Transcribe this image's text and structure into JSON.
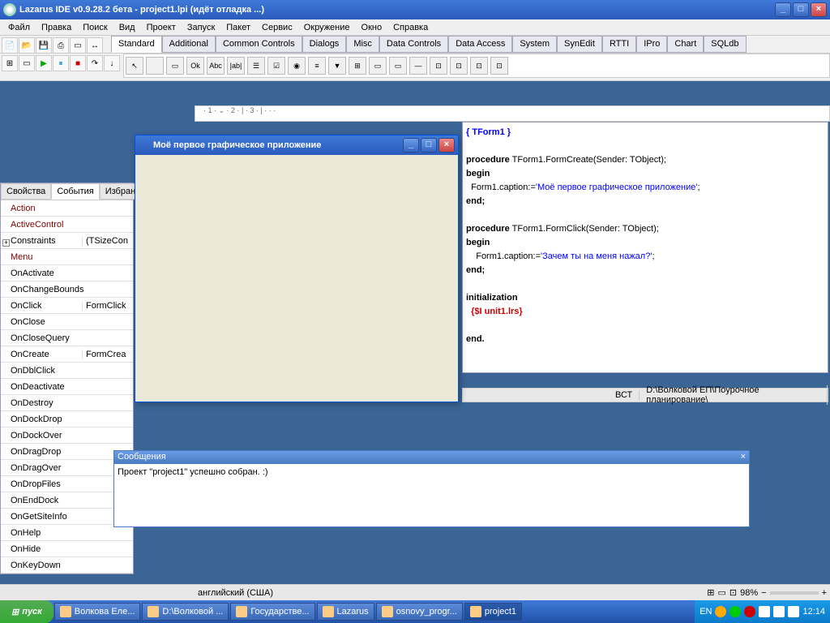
{
  "title": "Lazarus IDE v0.9.28.2 бета - project1.lpi (идёт отладка ...)",
  "menus": [
    "Файл",
    "Правка",
    "Поиск",
    "Вид",
    "Проект",
    "Запуск",
    "Пакет",
    "Сервис",
    "Окружение",
    "Окно",
    "Справка"
  ],
  "comp_tabs": [
    "Standard",
    "Additional",
    "Common Controls",
    "Dialogs",
    "Misc",
    "Data Controls",
    "Data Access",
    "System",
    "SynEdit",
    "RTTI",
    "IPro",
    "Chart",
    "SQLdb"
  ],
  "palette_icons": [
    "↖",
    "",
    "▭",
    "Ok",
    "Abc",
    "|ab|",
    "☰",
    "☑",
    "◉",
    "≡",
    "▼",
    "⊞",
    "▭",
    "▭",
    "—",
    "⊡",
    "⊡",
    "⊡",
    "⊡"
  ],
  "oi_tabs": [
    "Свойства",
    "События",
    "Избранн"
  ],
  "events": [
    {
      "n": "Action",
      "v": ""
    },
    {
      "n": "ActiveControl",
      "v": ""
    },
    {
      "n": "Constraints",
      "v": "(TSizeCon",
      "black": true,
      "plus": true
    },
    {
      "n": "Menu",
      "v": ""
    },
    {
      "n": "OnActivate",
      "v": "",
      "black": true
    },
    {
      "n": "OnChangeBounds",
      "v": "",
      "black": true
    },
    {
      "n": "OnClick",
      "v": "FormClick",
      "black": true
    },
    {
      "n": "OnClose",
      "v": "",
      "black": true
    },
    {
      "n": "OnCloseQuery",
      "v": "",
      "black": true
    },
    {
      "n": "OnCreate",
      "v": "FormCrea",
      "black": true
    },
    {
      "n": "OnDblClick",
      "v": "",
      "black": true
    },
    {
      "n": "OnDeactivate",
      "v": "",
      "black": true
    },
    {
      "n": "OnDestroy",
      "v": "",
      "black": true
    },
    {
      "n": "OnDockDrop",
      "v": "",
      "black": true
    },
    {
      "n": "OnDockOver",
      "v": "",
      "black": true
    },
    {
      "n": "OnDragDrop",
      "v": "",
      "black": true
    },
    {
      "n": "OnDragOver",
      "v": "",
      "black": true
    },
    {
      "n": "OnDropFiles",
      "v": "",
      "black": true
    },
    {
      "n": "OnEndDock",
      "v": "",
      "black": true
    },
    {
      "n": "OnGetSiteInfo",
      "v": "",
      "black": true
    },
    {
      "n": "OnHelp",
      "v": "",
      "black": true
    },
    {
      "n": "OnHide",
      "v": "",
      "black": true
    },
    {
      "n": "OnKeyDown",
      "v": "",
      "black": true
    }
  ],
  "app_title": "Моё первое графическое приложение",
  "code": {
    "l1a": "{ ",
    "l1b": "TForm1",
    "l1c": " }",
    "l2a": "procedure",
    "l2b": " TForm1.FormCreate(Sender: TObject);",
    "l3": "begin",
    "l4a": "  Form1.caption:=",
    "l4b": "'Моё первое графическое приложение'",
    "l4c": ";",
    "l5": "end;",
    "l6a": "procedure",
    "l6b": " TForm1.FormClick(Sender: TObject);",
    "l7": "begin",
    "l8a": "    Form1.caption:=",
    "l8b": "'Зачем ты на меня нажал?'",
    "l8c": ";",
    "l9": "end;",
    "l10": "initialization",
    "l11a": "  {$I unit1.lrs}",
    "l12": "end."
  },
  "status": {
    "mode": "ВСТ",
    "path": "D:\\Волковой ЕП\\Поурочное планирование\\"
  },
  "msg": {
    "title": "Сообщения",
    "body": "Проект \"project1\" успешно собран. :)"
  },
  "bottom": {
    "lang": "английский (США)",
    "zoom": "98%"
  },
  "start": "пуск",
  "tasks": [
    "Волкова Еле...",
    "D:\\Волковой ...",
    "Государстве...",
    "Lazarus",
    "osnovy_progr...",
    "project1"
  ],
  "tray": {
    "lang": "EN",
    "time": "12:14"
  }
}
